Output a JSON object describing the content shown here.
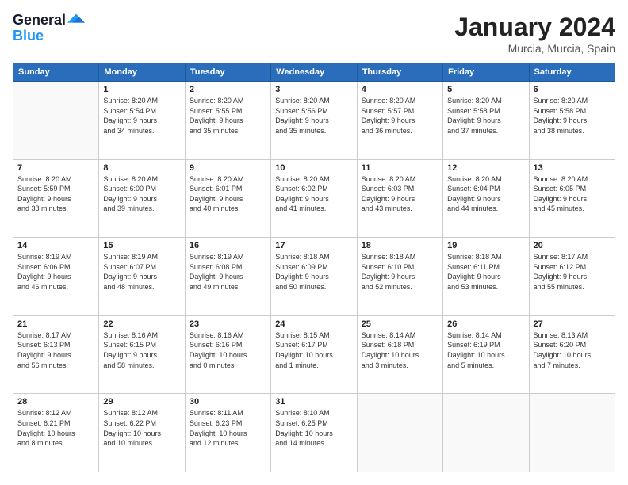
{
  "header": {
    "logo_line1": "General",
    "logo_line2": "Blue",
    "month": "January 2024",
    "location": "Murcia, Murcia, Spain"
  },
  "weekdays": [
    "Sunday",
    "Monday",
    "Tuesday",
    "Wednesday",
    "Thursday",
    "Friday",
    "Saturday"
  ],
  "weeks": [
    [
      {
        "day": "",
        "info": ""
      },
      {
        "day": "1",
        "info": "Sunrise: 8:20 AM\nSunset: 5:54 PM\nDaylight: 9 hours\nand 34 minutes."
      },
      {
        "day": "2",
        "info": "Sunrise: 8:20 AM\nSunset: 5:55 PM\nDaylight: 9 hours\nand 35 minutes."
      },
      {
        "day": "3",
        "info": "Sunrise: 8:20 AM\nSunset: 5:56 PM\nDaylight: 9 hours\nand 35 minutes."
      },
      {
        "day": "4",
        "info": "Sunrise: 8:20 AM\nSunset: 5:57 PM\nDaylight: 9 hours\nand 36 minutes."
      },
      {
        "day": "5",
        "info": "Sunrise: 8:20 AM\nSunset: 5:58 PM\nDaylight: 9 hours\nand 37 minutes."
      },
      {
        "day": "6",
        "info": "Sunrise: 8:20 AM\nSunset: 5:58 PM\nDaylight: 9 hours\nand 38 minutes."
      }
    ],
    [
      {
        "day": "7",
        "info": "Sunrise: 8:20 AM\nSunset: 5:59 PM\nDaylight: 9 hours\nand 38 minutes."
      },
      {
        "day": "8",
        "info": "Sunrise: 8:20 AM\nSunset: 6:00 PM\nDaylight: 9 hours\nand 39 minutes."
      },
      {
        "day": "9",
        "info": "Sunrise: 8:20 AM\nSunset: 6:01 PM\nDaylight: 9 hours\nand 40 minutes."
      },
      {
        "day": "10",
        "info": "Sunrise: 8:20 AM\nSunset: 6:02 PM\nDaylight: 9 hours\nand 41 minutes."
      },
      {
        "day": "11",
        "info": "Sunrise: 8:20 AM\nSunset: 6:03 PM\nDaylight: 9 hours\nand 43 minutes."
      },
      {
        "day": "12",
        "info": "Sunrise: 8:20 AM\nSunset: 6:04 PM\nDaylight: 9 hours\nand 44 minutes."
      },
      {
        "day": "13",
        "info": "Sunrise: 8:20 AM\nSunset: 6:05 PM\nDaylight: 9 hours\nand 45 minutes."
      }
    ],
    [
      {
        "day": "14",
        "info": "Sunrise: 8:19 AM\nSunset: 6:06 PM\nDaylight: 9 hours\nand 46 minutes."
      },
      {
        "day": "15",
        "info": "Sunrise: 8:19 AM\nSunset: 6:07 PM\nDaylight: 9 hours\nand 48 minutes."
      },
      {
        "day": "16",
        "info": "Sunrise: 8:19 AM\nSunset: 6:08 PM\nDaylight: 9 hours\nand 49 minutes."
      },
      {
        "day": "17",
        "info": "Sunrise: 8:18 AM\nSunset: 6:09 PM\nDaylight: 9 hours\nand 50 minutes."
      },
      {
        "day": "18",
        "info": "Sunrise: 8:18 AM\nSunset: 6:10 PM\nDaylight: 9 hours\nand 52 minutes."
      },
      {
        "day": "19",
        "info": "Sunrise: 8:18 AM\nSunset: 6:11 PM\nDaylight: 9 hours\nand 53 minutes."
      },
      {
        "day": "20",
        "info": "Sunrise: 8:17 AM\nSunset: 6:12 PM\nDaylight: 9 hours\nand 55 minutes."
      }
    ],
    [
      {
        "day": "21",
        "info": "Sunrise: 8:17 AM\nSunset: 6:13 PM\nDaylight: 9 hours\nand 56 minutes."
      },
      {
        "day": "22",
        "info": "Sunrise: 8:16 AM\nSunset: 6:15 PM\nDaylight: 9 hours\nand 58 minutes."
      },
      {
        "day": "23",
        "info": "Sunrise: 8:16 AM\nSunset: 6:16 PM\nDaylight: 10 hours\nand 0 minutes."
      },
      {
        "day": "24",
        "info": "Sunrise: 8:15 AM\nSunset: 6:17 PM\nDaylight: 10 hours\nand 1 minute."
      },
      {
        "day": "25",
        "info": "Sunrise: 8:14 AM\nSunset: 6:18 PM\nDaylight: 10 hours\nand 3 minutes."
      },
      {
        "day": "26",
        "info": "Sunrise: 8:14 AM\nSunset: 6:19 PM\nDaylight: 10 hours\nand 5 minutes."
      },
      {
        "day": "27",
        "info": "Sunrise: 8:13 AM\nSunset: 6:20 PM\nDaylight: 10 hours\nand 7 minutes."
      }
    ],
    [
      {
        "day": "28",
        "info": "Sunrise: 8:12 AM\nSunset: 6:21 PM\nDaylight: 10 hours\nand 8 minutes."
      },
      {
        "day": "29",
        "info": "Sunrise: 8:12 AM\nSunset: 6:22 PM\nDaylight: 10 hours\nand 10 minutes."
      },
      {
        "day": "30",
        "info": "Sunrise: 8:11 AM\nSunset: 6:23 PM\nDaylight: 10 hours\nand 12 minutes."
      },
      {
        "day": "31",
        "info": "Sunrise: 8:10 AM\nSunset: 6:25 PM\nDaylight: 10 hours\nand 14 minutes."
      },
      {
        "day": "",
        "info": ""
      },
      {
        "day": "",
        "info": ""
      },
      {
        "day": "",
        "info": ""
      }
    ]
  ]
}
